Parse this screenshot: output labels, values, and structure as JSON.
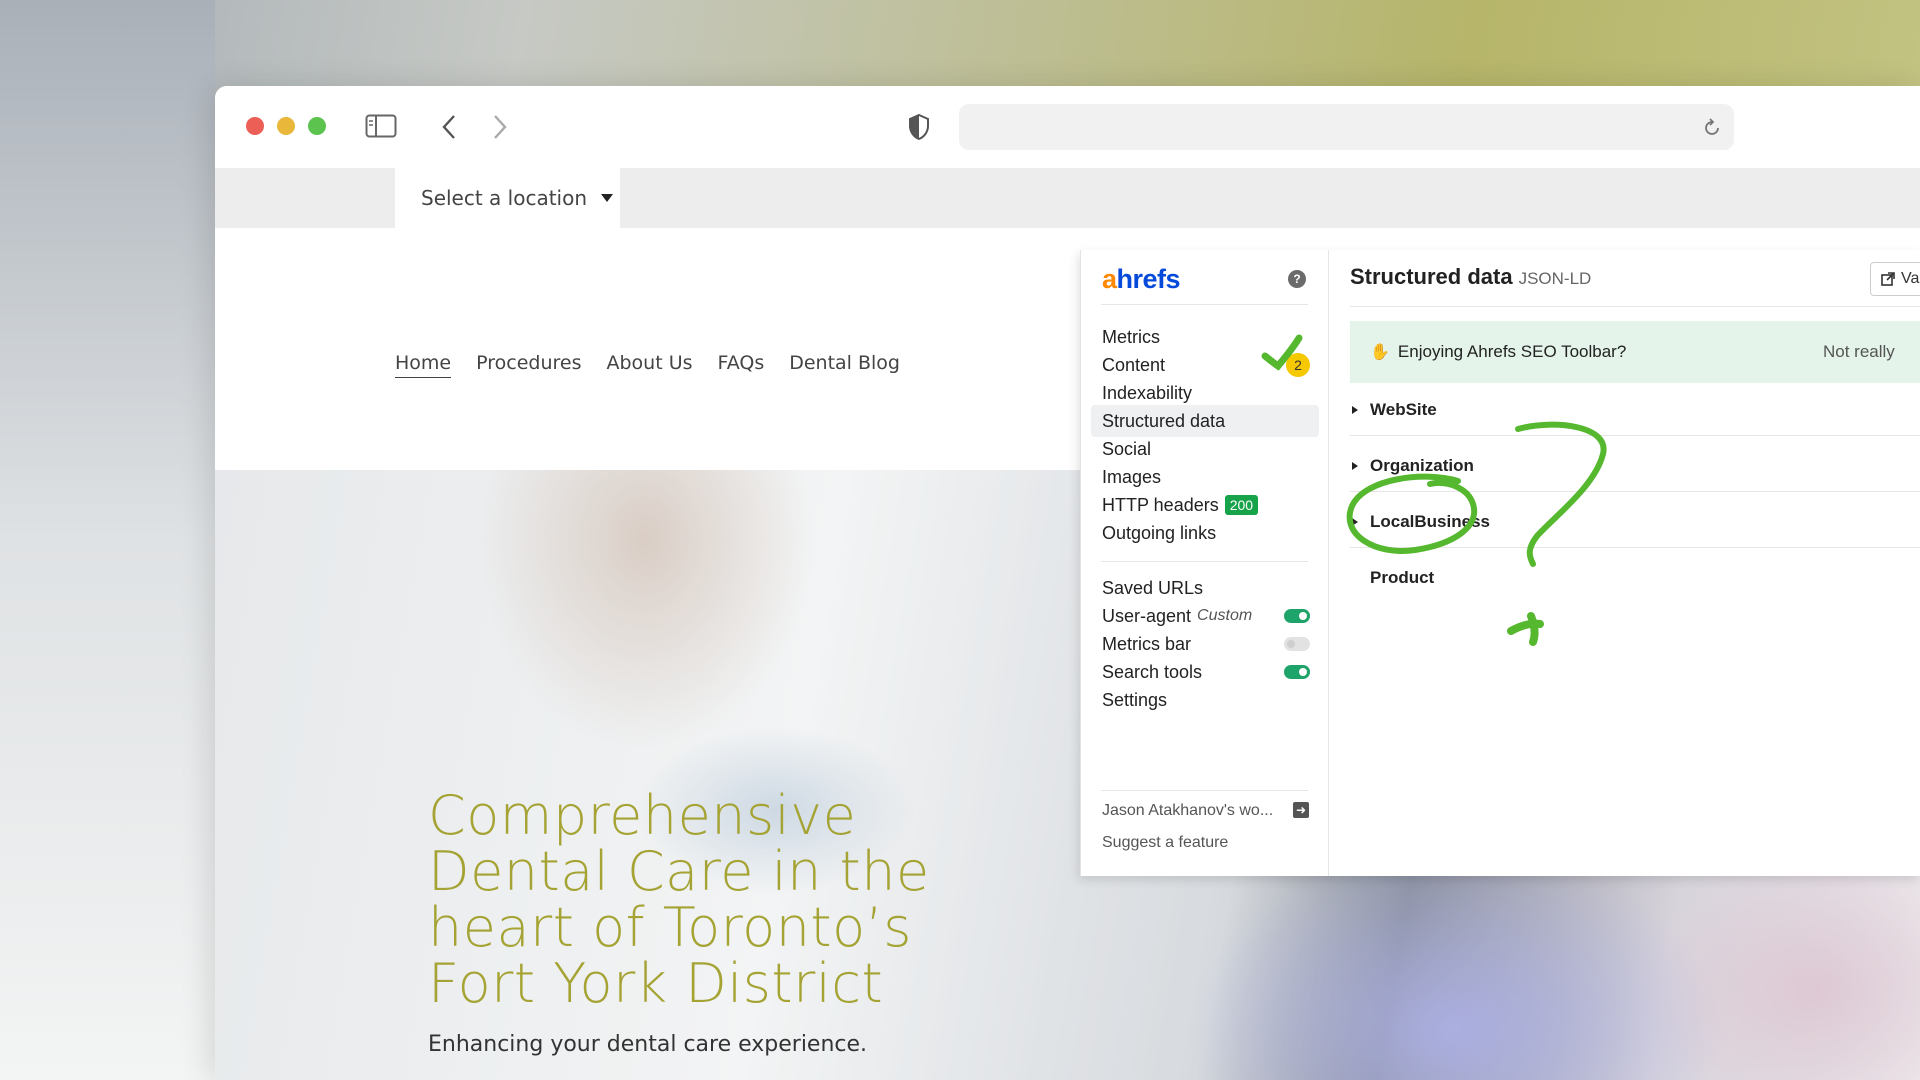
{
  "browser": {
    "icons": [
      "sidebar-icon",
      "back-icon",
      "forward-icon",
      "shield-icon",
      "reload-icon"
    ],
    "address": ""
  },
  "site": {
    "location_select": "Select a location",
    "nav": [
      "Home",
      "Procedures",
      "About Us",
      "FAQs",
      "Dental Blog"
    ],
    "hero_title": "Comprehensive Dental Care in the heart of Toronto’s Fort York District",
    "hero_subtitle": "Enhancing your dental care experience."
  },
  "ahrefs": {
    "logo_a": "a",
    "logo_rest": "hrefs",
    "menu": {
      "metrics": "Metrics",
      "content": "Content",
      "content_badge": "2",
      "indexability": "Indexability",
      "structured_data": "Structured data",
      "social": "Social",
      "images": "Images",
      "http_headers": "HTTP headers",
      "http_badge": "200",
      "outgoing_links": "Outgoing links",
      "saved_urls": "Saved URLs",
      "user_agent": "User-agent",
      "user_agent_value": "Custom",
      "metrics_bar": "Metrics bar",
      "search_tools": "Search tools",
      "settings": "Settings",
      "account": "Jason Atakhanov's wo...",
      "suggest": "Suggest a feature"
    },
    "toggles": {
      "user_agent": true,
      "metrics_bar": false,
      "search_tools": true
    },
    "structured_data": {
      "title": "Structured data",
      "format": "JSON-LD",
      "external_button": "Va",
      "banner_text": "Enjoying Ahrefs SEO Toolbar?",
      "banner_action": "Not really",
      "items": [
        "WebSite",
        "Organization",
        "LocalBusiness",
        "Product"
      ]
    }
  },
  "colors": {
    "hero_title": "#a5a334",
    "logo_orange": "#ff8800",
    "logo_blue": "#054ada",
    "annotation_green": "#55b82e",
    "toggle_on": "#1ea36b",
    "badge_yellow": "#f5c800",
    "badge_green": "#17a34a"
  }
}
